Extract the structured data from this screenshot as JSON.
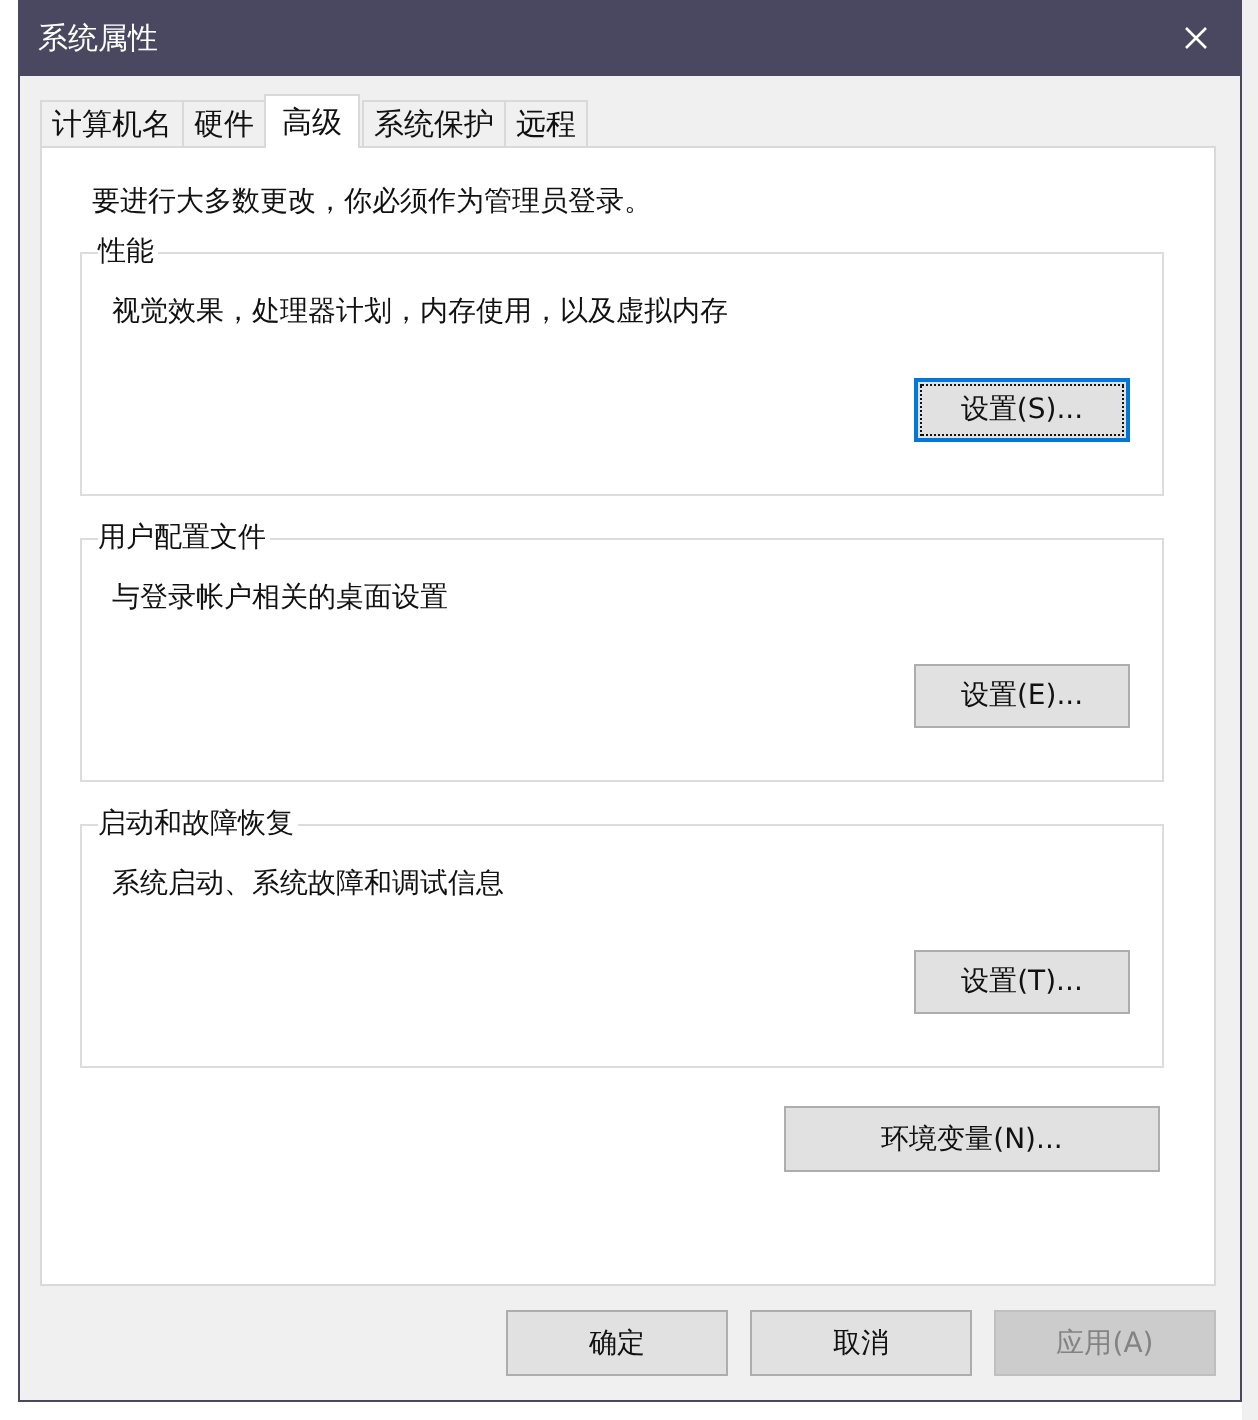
{
  "window": {
    "title": "系统属性"
  },
  "tabs": [
    {
      "label": "计算机名",
      "selected": false
    },
    {
      "label": "硬件",
      "selected": false
    },
    {
      "label": "高级",
      "selected": true
    },
    {
      "label": "系统保护",
      "selected": false
    },
    {
      "label": "远程",
      "selected": false
    }
  ],
  "notice": "要进行大多数更改，你必须作为管理员登录。",
  "groups": [
    {
      "title": "性能",
      "description": "视觉效果，处理器计划，内存使用，以及虚拟内存",
      "button": "设置(S)...",
      "focused": true
    },
    {
      "title": "用户配置文件",
      "description": "与登录帐户相关的桌面设置",
      "button": "设置(E)...",
      "focused": false
    },
    {
      "title": "启动和故障恢复",
      "description": "系统启动、系统故障和调试信息",
      "button": "设置(T)...",
      "focused": false
    }
  ],
  "environment_button": "环境变量(N)...",
  "buttons": [
    {
      "label": "确定",
      "disabled": false
    },
    {
      "label": "取消",
      "disabled": false
    },
    {
      "label": "应用(A)",
      "disabled": true
    }
  ]
}
